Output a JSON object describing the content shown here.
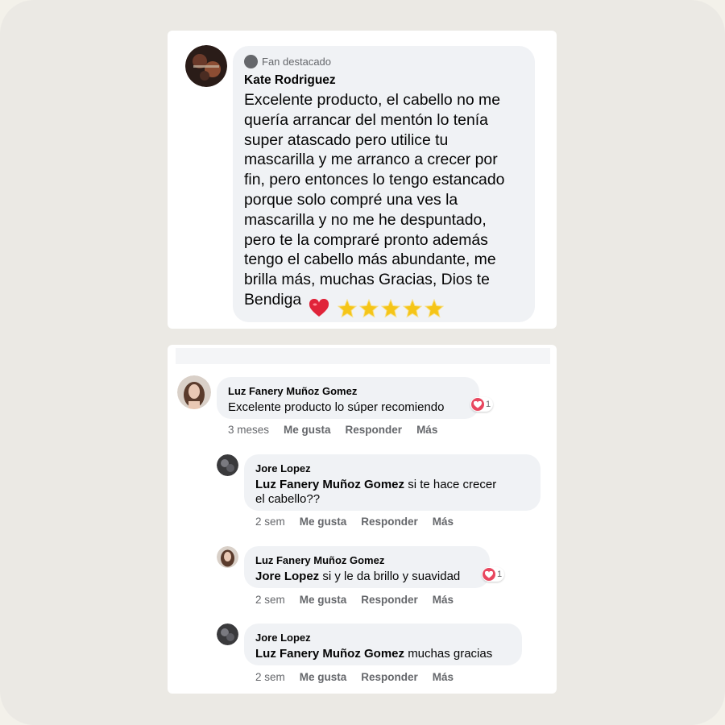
{
  "featured": {
    "badge": "Fan destacado",
    "name": "Kate Rodriguez",
    "lines": [
      "Excelente producto, el cabello no me",
      "quería arrancar del mentón lo tenía",
      "super atascado pero utilice tu",
      "mascarilla y me arranco a crecer por",
      "fin, pero entonces lo tengo estancado",
      "porque solo compré una ves la",
      "mascarilla y no me he despuntado,",
      "pero te la compraré pronto además",
      "tengo el cabello más abundante, me",
      "brilla más, muchas Gracias, Dios te",
      "Bendiga"
    ],
    "emoji": [
      "red-heart",
      "glowing-star",
      "glowing-star",
      "glowing-star",
      "glowing-star",
      "glowing-star"
    ]
  },
  "comments": [
    {
      "name": "Luz Fanery Muñoz Gomez",
      "mention": "",
      "text": "Excelente producto lo súper recomiendo",
      "reactions": "1",
      "time": "3 meses",
      "like": "Me gusta",
      "reply": "Responder",
      "more": "Más"
    },
    {
      "name": "Jore Lopez",
      "mention": "Luz Fanery Muñoz Gomez",
      "text": "si te hace crecer",
      "text2": "el cabello??",
      "time": "2 sem",
      "like": "Me gusta",
      "reply": "Responder",
      "more": "Más"
    },
    {
      "name": "Luz Fanery Muñoz Gomez",
      "mention": "Jore Lopez",
      "text": "si y le da brillo y suavidad",
      "reactions": "1",
      "time": "2 sem",
      "like": "Me gusta",
      "reply": "Responder",
      "more": "Más"
    },
    {
      "name": "Jore Lopez",
      "mention": "Luz Fanery Muñoz Gomez",
      "text": "muchas gracias",
      "time": "2 sem",
      "like": "Me gusta",
      "reply": "Responder",
      "more": "Más"
    }
  ],
  "colors": {
    "bubble": "#f0f2f5",
    "muted": "#65676b",
    "heart": "#e8475f",
    "star": "#f5c518"
  }
}
